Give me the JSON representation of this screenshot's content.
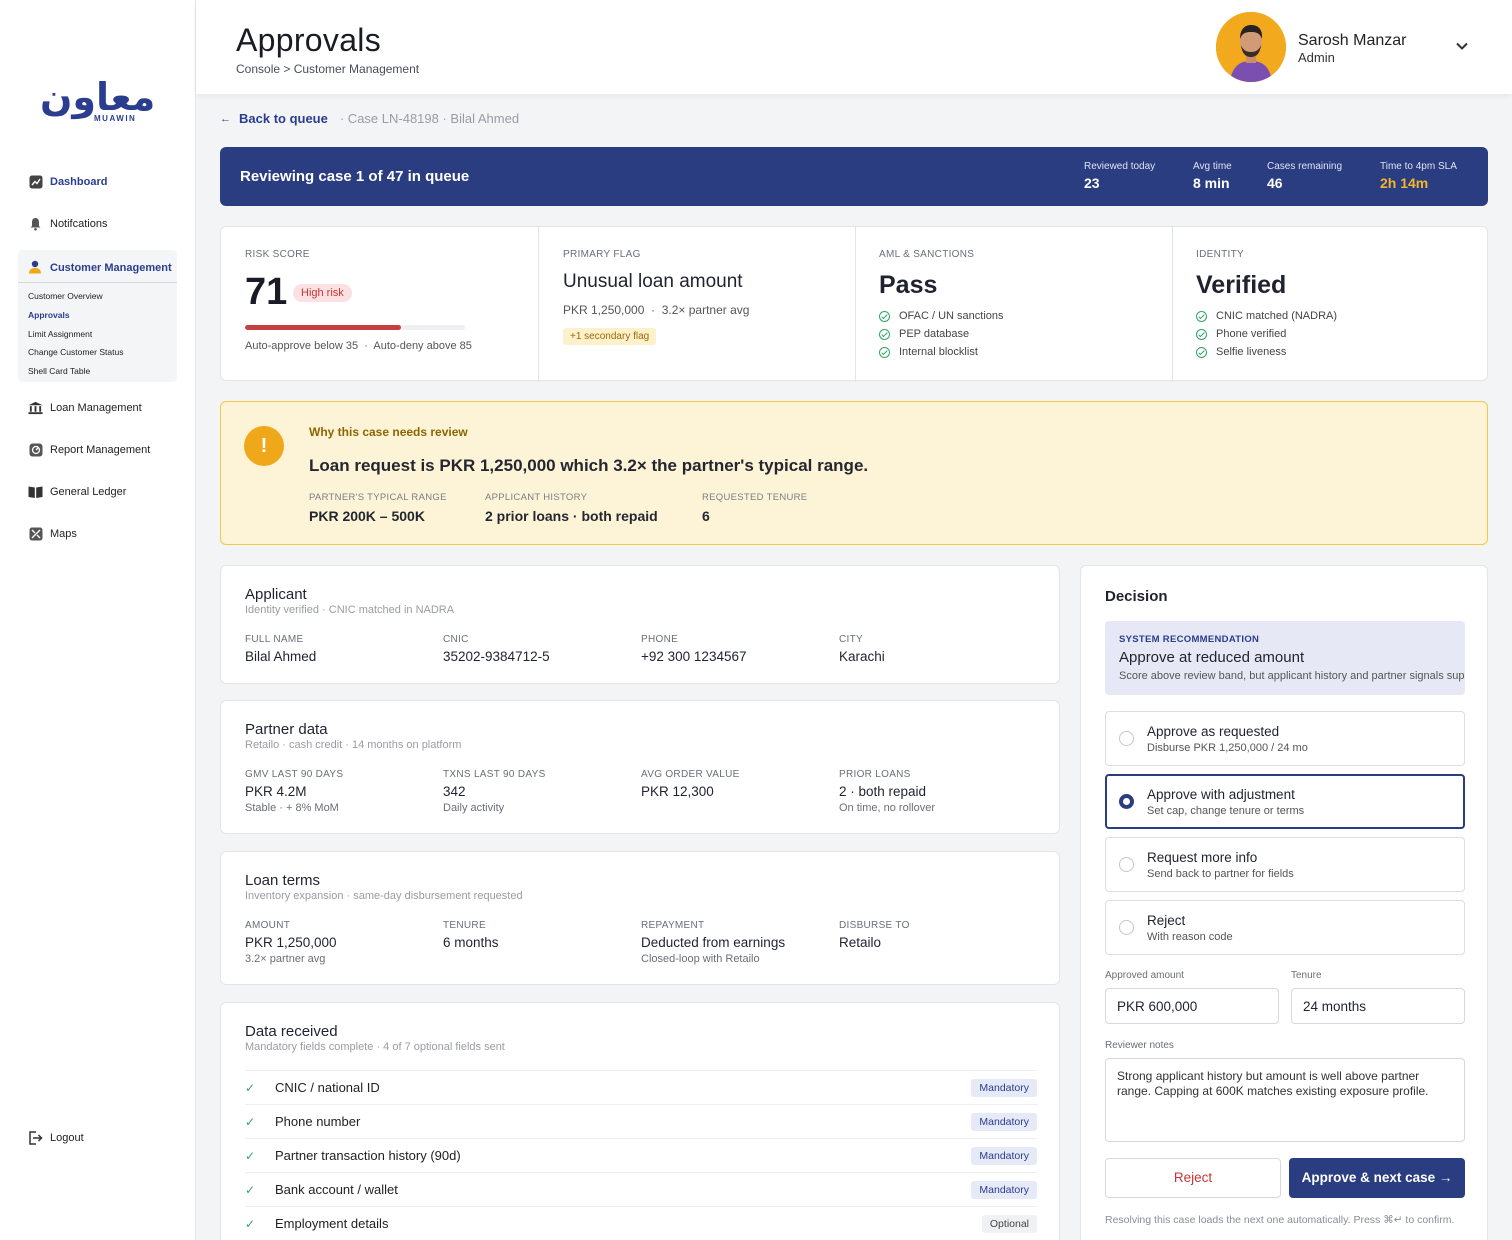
{
  "sidebar": {
    "logo_ar": "معاون",
    "logo_en": "MUAWIN",
    "items": {
      "dashboard": "Dashboard",
      "notifications": "Notifcations",
      "customer_management": "Customer Management",
      "loan_management": "Loan Management",
      "report_management": "Report Management",
      "general_ledger": "General Ledger",
      "maps": "Maps",
      "logout": "Logout"
    },
    "sub_items": [
      "Customer Overview",
      "Approvals",
      "Limit Assignment",
      "Change Customer Status",
      "Shell Card Table"
    ]
  },
  "header": {
    "title": "Approvals",
    "breadcrumb": "Console > Customer Management",
    "user_name": "Sarosh Manzar",
    "user_role": "Admin"
  },
  "back": {
    "label": "Back to queue",
    "case_ref": "· Case LN-48198 · Bilal Ahmed"
  },
  "queue": {
    "title": "Reviewing case 1 of 47 in queue",
    "stats": [
      {
        "label": "Reviewed today",
        "value": "23"
      },
      {
        "label": "Avg time",
        "value": "8 min"
      },
      {
        "label": "Cases remaining",
        "value": "46"
      },
      {
        "label": "Time to 4pm SLA",
        "value": "2h 14m"
      }
    ]
  },
  "summary": {
    "risk": {
      "label": "Risk score",
      "value": "71",
      "badge": "High risk",
      "bar_percent": 71,
      "note": "Auto-approve below 35  ·  Auto-deny above 85"
    },
    "flag": {
      "label": "Primary flag",
      "title": "Unusual loan amount",
      "detail": "PKR 1,250,000  ·  3.2× partner avg",
      "chip": "+1 secondary flag"
    },
    "aml": {
      "label": "AML & sanctions",
      "title": "Pass",
      "checks": [
        "OFAC / UN sanctions",
        "PEP database",
        "Internal blocklist"
      ]
    },
    "identity": {
      "label": "Identity",
      "title": "Verified",
      "checks": [
        "CNIC matched (NADRA)",
        "Phone verified",
        "Selfie liveness"
      ]
    }
  },
  "why": {
    "heading": "Why this case needs review",
    "main": "Loan request is PKR 1,250,000 which 3.2× the partner's typical range.",
    "cols": [
      {
        "label": "Partner's typical range",
        "value": "PKR 200K – 500K"
      },
      {
        "label": "Applicant history",
        "value": "2 prior loans · both repaid"
      },
      {
        "label": "Requested tenure",
        "value": "6"
      }
    ]
  },
  "applicant": {
    "title": "Applicant",
    "sub": "Identity verified · CNIC matched in NADRA",
    "fields": [
      {
        "label": "Full name",
        "value": "Bilal Ahmed"
      },
      {
        "label": "CNIC",
        "value": "35202-9384712-5"
      },
      {
        "label": "Phone",
        "value": "+92 300 1234567"
      },
      {
        "label": "City",
        "value": "Karachi"
      }
    ]
  },
  "partner": {
    "title": "Partner data",
    "sub": "Retailo · cash credit · 14 months on platform",
    "fields": [
      {
        "label": "GMV last 90 days",
        "value": "PKR 4.2M",
        "sub": "Stable · + 8% MoM"
      },
      {
        "label": "Txns last 90 days",
        "value": "342",
        "sub": "Daily activity"
      },
      {
        "label": "Avg order value",
        "value": "PKR 12,300",
        "sub": ""
      },
      {
        "label": "Prior loans",
        "value": "2 · both repaid",
        "sub": "On time, no rollover"
      }
    ]
  },
  "loan": {
    "title": "Loan terms",
    "sub": "Inventory expansion · same-day disbursement requested",
    "fields": [
      {
        "label": "Amount",
        "value": "PKR 1,250,000",
        "sub": "3.2× partner avg"
      },
      {
        "label": "Tenure",
        "value": "6 months",
        "sub": ""
      },
      {
        "label": "Repayment",
        "value": "Deducted from earnings",
        "sub": "Closed-loop with Retailo"
      },
      {
        "label": "Disburse to",
        "value": "Retailo",
        "sub": ""
      }
    ]
  },
  "data_received": {
    "title": "Data received",
    "sub": "Mandatory fields complete · 4 of 7 optional fields sent",
    "rows": [
      {
        "name": "CNIC / national ID",
        "tag": "Mandatory"
      },
      {
        "name": "Phone number",
        "tag": "Mandatory"
      },
      {
        "name": "Partner transaction history (90d)",
        "tag": "Mandatory"
      },
      {
        "name": "Bank account / wallet",
        "tag": "Mandatory"
      },
      {
        "name": "Employment details",
        "tag": "Optional"
      }
    ]
  },
  "decision": {
    "title": "Decision",
    "rec_label": "System recommendation",
    "rec_title": "Approve at reduced amount",
    "rec_desc": "Score above review band, but applicant history and partner signals support a reduced cap.",
    "options": [
      {
        "title": "Approve as requested",
        "desc": "Disburse PKR 1,250,000 / 24 mo",
        "selected": false
      },
      {
        "title": "Approve with adjustment",
        "desc": "Set cap, change tenure or terms",
        "selected": true
      },
      {
        "title": "Request more info",
        "desc": "Send back to partner for fields",
        "selected": false
      },
      {
        "title": "Reject",
        "desc": "With reason code",
        "selected": false
      }
    ],
    "amount_label": "Approved amount",
    "amount_value": "PKR 600,000",
    "tenure_label": "Tenure",
    "tenure_value": "24 months",
    "notes_label": "Reviewer notes",
    "notes_value": "Strong applicant history but amount is well above partner range. Capping at 600K matches existing exposure profile.",
    "reject_label": "Reject",
    "approve_label": "Approve & next case →",
    "footnote": "Resolving this case loads the next one automatically. Press ⌘↵ to confirm."
  },
  "colors": {
    "primary": "#2a3d80",
    "accent": "#f0a81b",
    "danger": "#c73535",
    "success": "#2ea566"
  }
}
